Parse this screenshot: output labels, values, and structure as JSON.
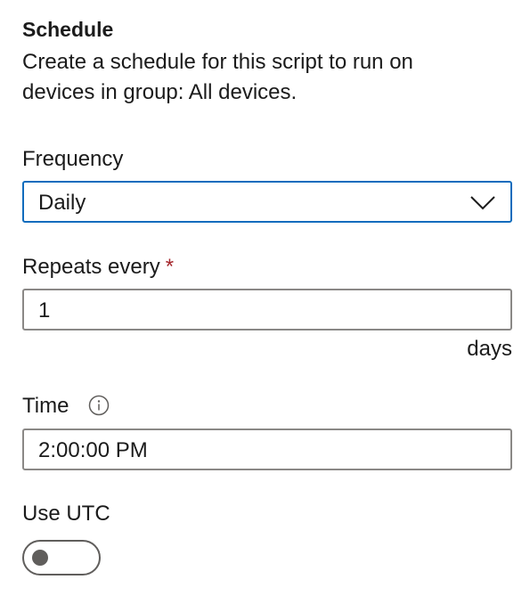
{
  "schedule": {
    "title": "Schedule",
    "description": "Create a schedule for this script to run on devices in group: All devices."
  },
  "frequency": {
    "label": "Frequency",
    "value": "Daily",
    "icon": "chevron-down-icon"
  },
  "repeats": {
    "label": "Repeats every",
    "required_mark": "*",
    "value": "1",
    "unit": "days"
  },
  "time": {
    "label": "Time",
    "info_icon": "info-icon",
    "value": "2:00:00 PM"
  },
  "utc": {
    "label": "Use UTC",
    "enabled": false
  },
  "colors": {
    "focus_border": "#0f6cbd",
    "border": "#8a8886",
    "required": "#a4262c",
    "toggle": "#605e5c"
  }
}
